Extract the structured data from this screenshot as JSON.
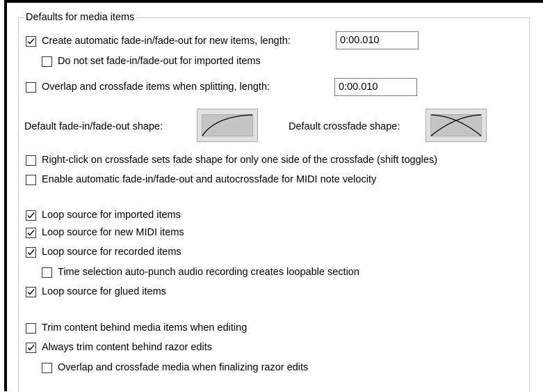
{
  "group_title": "Defaults for media items",
  "items": {
    "auto_fade": {
      "label": "Create automatic fade-in/fade-out for new items, length:",
      "checked": true
    },
    "no_fade_imported": {
      "label": "Do not set fade-in/fade-out for imported items",
      "checked": false
    },
    "overlap_crossfade": {
      "label": "Overlap and crossfade items when splitting, length:",
      "checked": false
    },
    "right_click_crossfade": {
      "label": "Right-click on crossfade sets fade shape for only one side of the crossfade (shift toggles)",
      "checked": false
    },
    "midi_velocity": {
      "label": "Enable automatic fade-in/fade-out and autocrossfade for MIDI note velocity",
      "checked": false
    },
    "loop_imported": {
      "label": "Loop source for imported items",
      "checked": true
    },
    "loop_midi": {
      "label": "Loop source for new MIDI items",
      "checked": true
    },
    "loop_recorded": {
      "label": "Loop source for recorded items",
      "checked": true
    },
    "time_selection": {
      "label": "Time selection auto-punch audio recording creates loopable section",
      "checked": false
    },
    "loop_glued": {
      "label": "Loop source for glued items",
      "checked": true
    },
    "trim_content": {
      "label": "Trim content behind media items when editing",
      "checked": false
    },
    "trim_razor": {
      "label": "Always trim content behind razor edits",
      "checked": true
    },
    "overlap_razor": {
      "label": "Overlap and crossfade media when finalizing razor edits",
      "checked": false
    }
  },
  "fields": {
    "fade_length": "0:00.010",
    "crossfade_length": "0:00.010"
  },
  "shapes": {
    "fade_label": "Default fade-in/fade-out shape:",
    "crossfade_label": "Default crossfade shape:"
  }
}
